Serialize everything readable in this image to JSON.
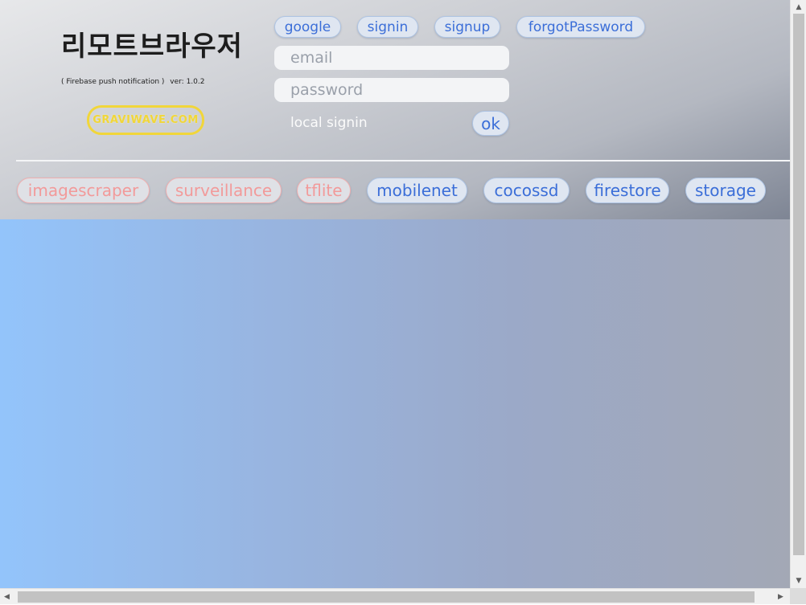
{
  "header": {
    "title": "리모트브라우저",
    "subtitle": "( Firebase push notification )",
    "version": "ver: 1.0.2",
    "logo_text": "GRAVIWAVE.COM"
  },
  "auth": {
    "buttons": {
      "google": "google",
      "signin": "signin",
      "signup": "signup",
      "forgot": "forgotPassword"
    },
    "email_placeholder": "email",
    "email_value": "",
    "password_placeholder": "password",
    "password_value": "",
    "local_signin_label": "local signin",
    "ok_label": "ok"
  },
  "nav": {
    "items": [
      {
        "label": "imagescraper",
        "state": "disabled"
      },
      {
        "label": "surveillance",
        "state": "disabled"
      },
      {
        "label": "tflite",
        "state": "disabled"
      },
      {
        "label": "mobilenet",
        "state": "enabled"
      },
      {
        "label": "cocossd",
        "state": "enabled"
      },
      {
        "label": "firestore",
        "state": "enabled"
      },
      {
        "label": "storage",
        "state": "enabled"
      }
    ]
  },
  "colors": {
    "accent_blue": "#3b6ed8",
    "disabled_pink": "#f29a9a",
    "logo_yellow": "#f1d63a"
  },
  "icons": {
    "scroll_up": "▲",
    "scroll_down": "▼",
    "scroll_left": "◀",
    "scroll_right": "▶"
  }
}
